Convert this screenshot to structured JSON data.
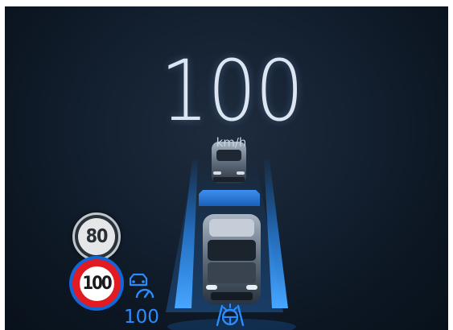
{
  "speed": {
    "value": "100",
    "unit": "km/h"
  },
  "traffic_signs": {
    "advisory_limit": "80",
    "speed_limit": "100"
  },
  "cruise_control": {
    "set_speed": "100"
  },
  "icons": [
    "smart-cruise-control-icon",
    "lane-following-assist-icon"
  ],
  "colors": {
    "accent": "#2b8cff",
    "lane": "#1f7fe6",
    "background": "#101c2a",
    "speed_text": "#dce6f2",
    "sign_red": "#e21b23"
  }
}
